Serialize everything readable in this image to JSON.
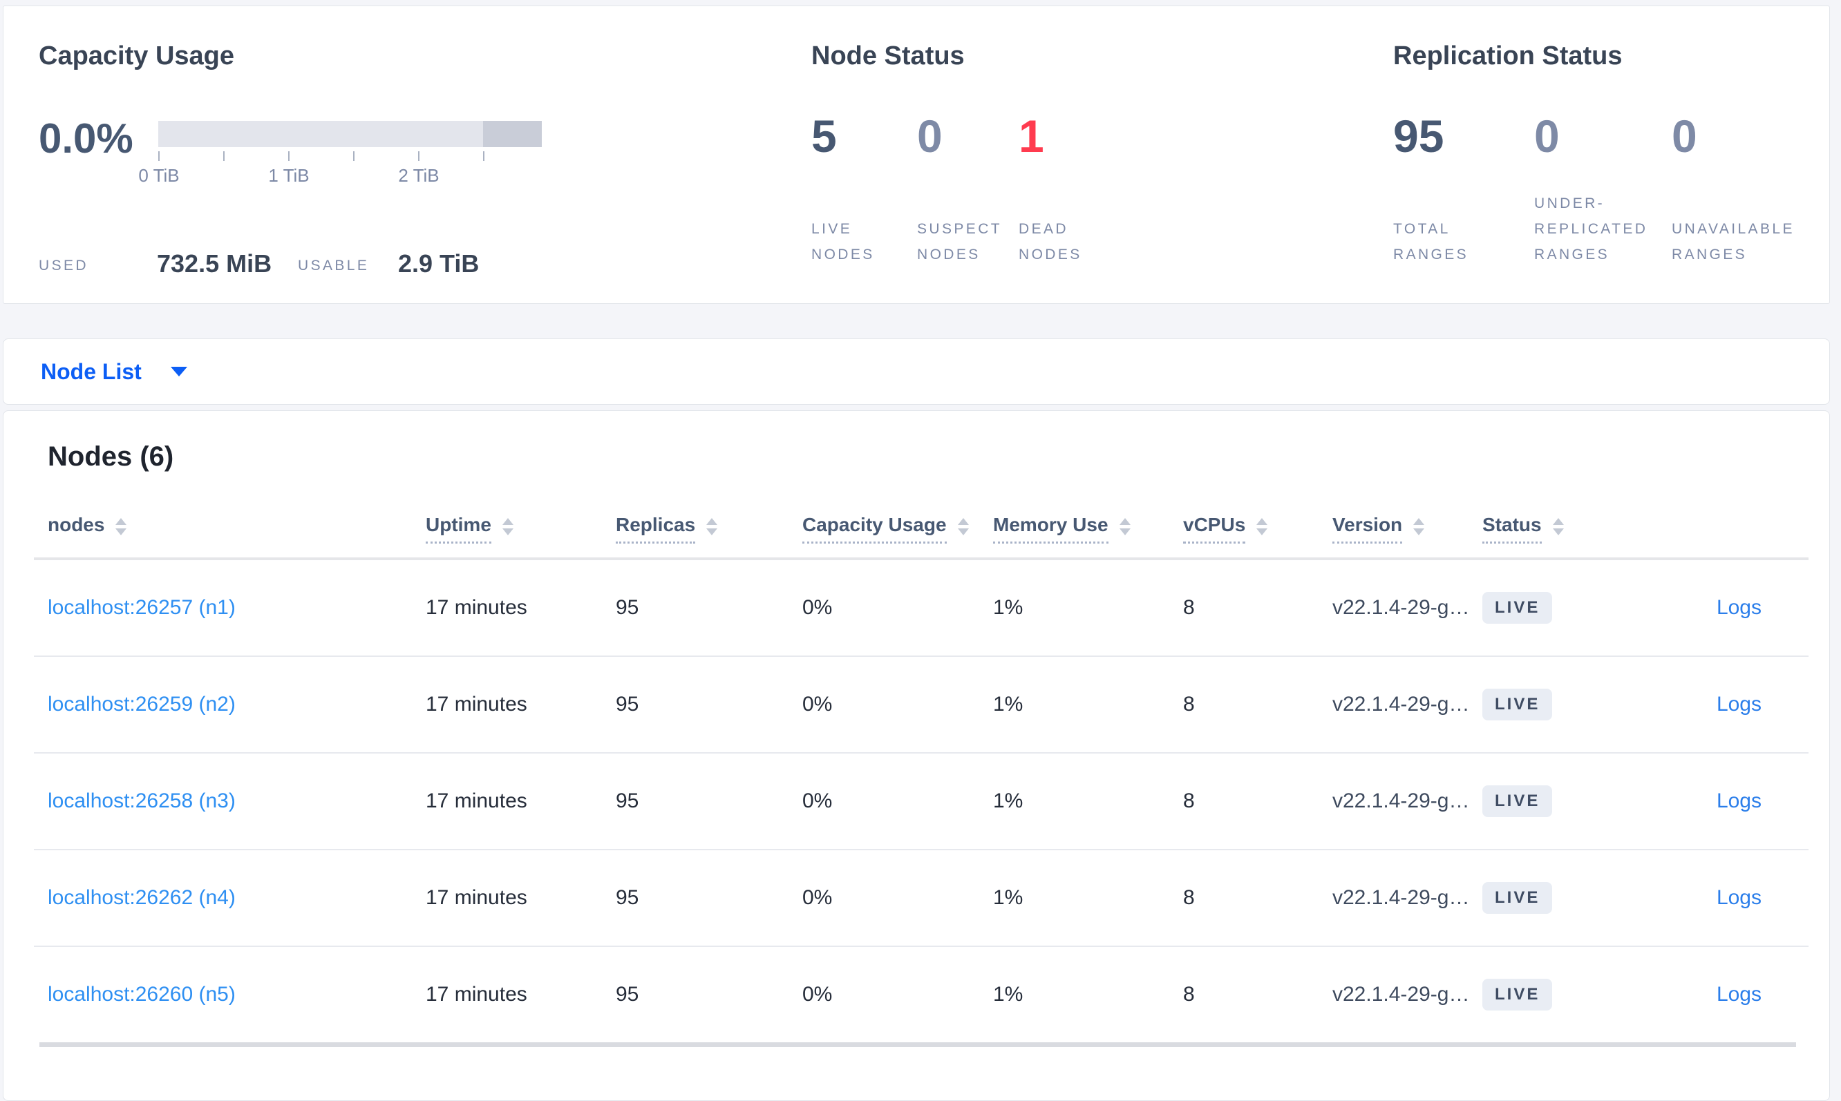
{
  "summary": {
    "capacity": {
      "title": "Capacity Usage",
      "percent": "0.0%",
      "ticks": [
        "0 TiB",
        "1 TiB",
        "2 TiB"
      ],
      "used_label": "USED",
      "used_value": "732.5 MiB",
      "usable_label": "USABLE",
      "usable_value": "2.9 TiB"
    },
    "node_status": {
      "title": "Node Status",
      "metrics": [
        {
          "value": "5",
          "label_lines": [
            "LIVE",
            "NODES"
          ],
          "tone": "dark"
        },
        {
          "value": "0",
          "label_lines": [
            "SUSPECT",
            "NODES"
          ],
          "tone": "muted"
        },
        {
          "value": "1",
          "label_lines": [
            "DEAD",
            "NODES"
          ],
          "tone": "danger"
        }
      ]
    },
    "replication": {
      "title": "Replication Status",
      "metrics": [
        {
          "value": "95",
          "label_lines": [
            "TOTAL",
            "RANGES"
          ],
          "tone": "dark"
        },
        {
          "value": "0",
          "label_lines": [
            "UNDER-",
            "REPLICATED",
            "RANGES"
          ],
          "tone": "muted"
        },
        {
          "value": "0",
          "label_lines": [
            "UNAVAILABLE",
            "RANGES"
          ],
          "tone": "muted"
        }
      ]
    }
  },
  "view_selector": {
    "label": "Node List"
  },
  "nodes_section": {
    "title": "Nodes (6)",
    "columns": [
      {
        "label": "nodes",
        "sortable_underline": false
      },
      {
        "label": "Uptime",
        "sortable_underline": true
      },
      {
        "label": "Replicas",
        "sortable_underline": true
      },
      {
        "label": "Capacity Usage",
        "sortable_underline": true
      },
      {
        "label": "Memory Use",
        "sortable_underline": true
      },
      {
        "label": "vCPUs",
        "sortable_underline": true
      },
      {
        "label": "Version",
        "sortable_underline": true
      },
      {
        "label": "Status",
        "sortable_underline": true
      }
    ],
    "rows": [
      {
        "node": "localhost:26257 (n1)",
        "uptime": "17 minutes",
        "replicas": "95",
        "capacity": "0%",
        "memory": "1%",
        "vcpus": "8",
        "version": "v22.1.4-29-g…",
        "status": "LIVE",
        "logs": "Logs"
      },
      {
        "node": "localhost:26259 (n2)",
        "uptime": "17 minutes",
        "replicas": "95",
        "capacity": "0%",
        "memory": "1%",
        "vcpus": "8",
        "version": "v22.1.4-29-g…",
        "status": "LIVE",
        "logs": "Logs"
      },
      {
        "node": "localhost:26258 (n3)",
        "uptime": "17 minutes",
        "replicas": "95",
        "capacity": "0%",
        "memory": "1%",
        "vcpus": "8",
        "version": "v22.1.4-29-g…",
        "status": "LIVE",
        "logs": "Logs"
      },
      {
        "node": "localhost:26262 (n4)",
        "uptime": "17 minutes",
        "replicas": "95",
        "capacity": "0%",
        "memory": "1%",
        "vcpus": "8",
        "version": "v22.1.4-29-g…",
        "status": "LIVE",
        "logs": "Logs"
      },
      {
        "node": "localhost:26260 (n5)",
        "uptime": "17 minutes",
        "replicas": "95",
        "capacity": "0%",
        "memory": "1%",
        "vcpus": "8",
        "version": "v22.1.4-29-g…",
        "status": "LIVE",
        "logs": "Logs"
      }
    ]
  },
  "colors": {
    "accent_blue": "#0c5ef5",
    "node_link_blue": "#2e8ff2",
    "logs_link_blue": "#2b7eea",
    "danger_red": "#ff3b4f",
    "badge_bg": "#e9edf4",
    "badge_text": "#3f4c63",
    "bar_light": "#e3e5ec",
    "bar_dark": "#c9cdd8"
  }
}
